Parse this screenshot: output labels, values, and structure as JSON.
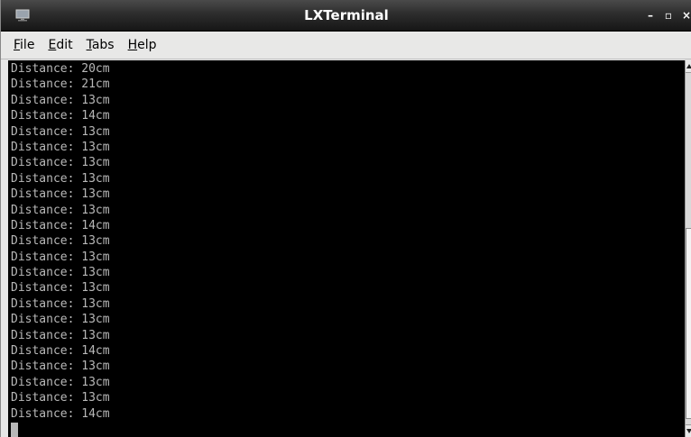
{
  "window": {
    "title": "LXTerminal",
    "minimize_glyph": "–",
    "maximize_glyph": "▫",
    "close_glyph": "×",
    "icon": "terminal-app-icon"
  },
  "menubar": {
    "items": [
      {
        "mnemonic": "F",
        "rest": "ile"
      },
      {
        "mnemonic": "E",
        "rest": "dit"
      },
      {
        "mnemonic": "T",
        "rest": "abs"
      },
      {
        "mnemonic": "H",
        "rest": "elp"
      }
    ]
  },
  "terminal": {
    "lines": [
      "Distance: 20cm",
      "Distance: 21cm",
      "Distance: 13cm",
      "Distance: 14cm",
      "Distance: 13cm",
      "Distance: 13cm",
      "Distance: 13cm",
      "Distance: 13cm",
      "Distance: 13cm",
      "Distance: 13cm",
      "Distance: 14cm",
      "Distance: 13cm",
      "Distance: 13cm",
      "Distance: 13cm",
      "Distance: 13cm",
      "Distance: 13cm",
      "Distance: 13cm",
      "Distance: 13cm",
      "Distance: 14cm",
      "Distance: 13cm",
      "Distance: 13cm",
      "Distance: 13cm",
      "Distance: 14cm"
    ],
    "colors": {
      "background": "#000000",
      "foreground": "#b8b8b8"
    }
  }
}
